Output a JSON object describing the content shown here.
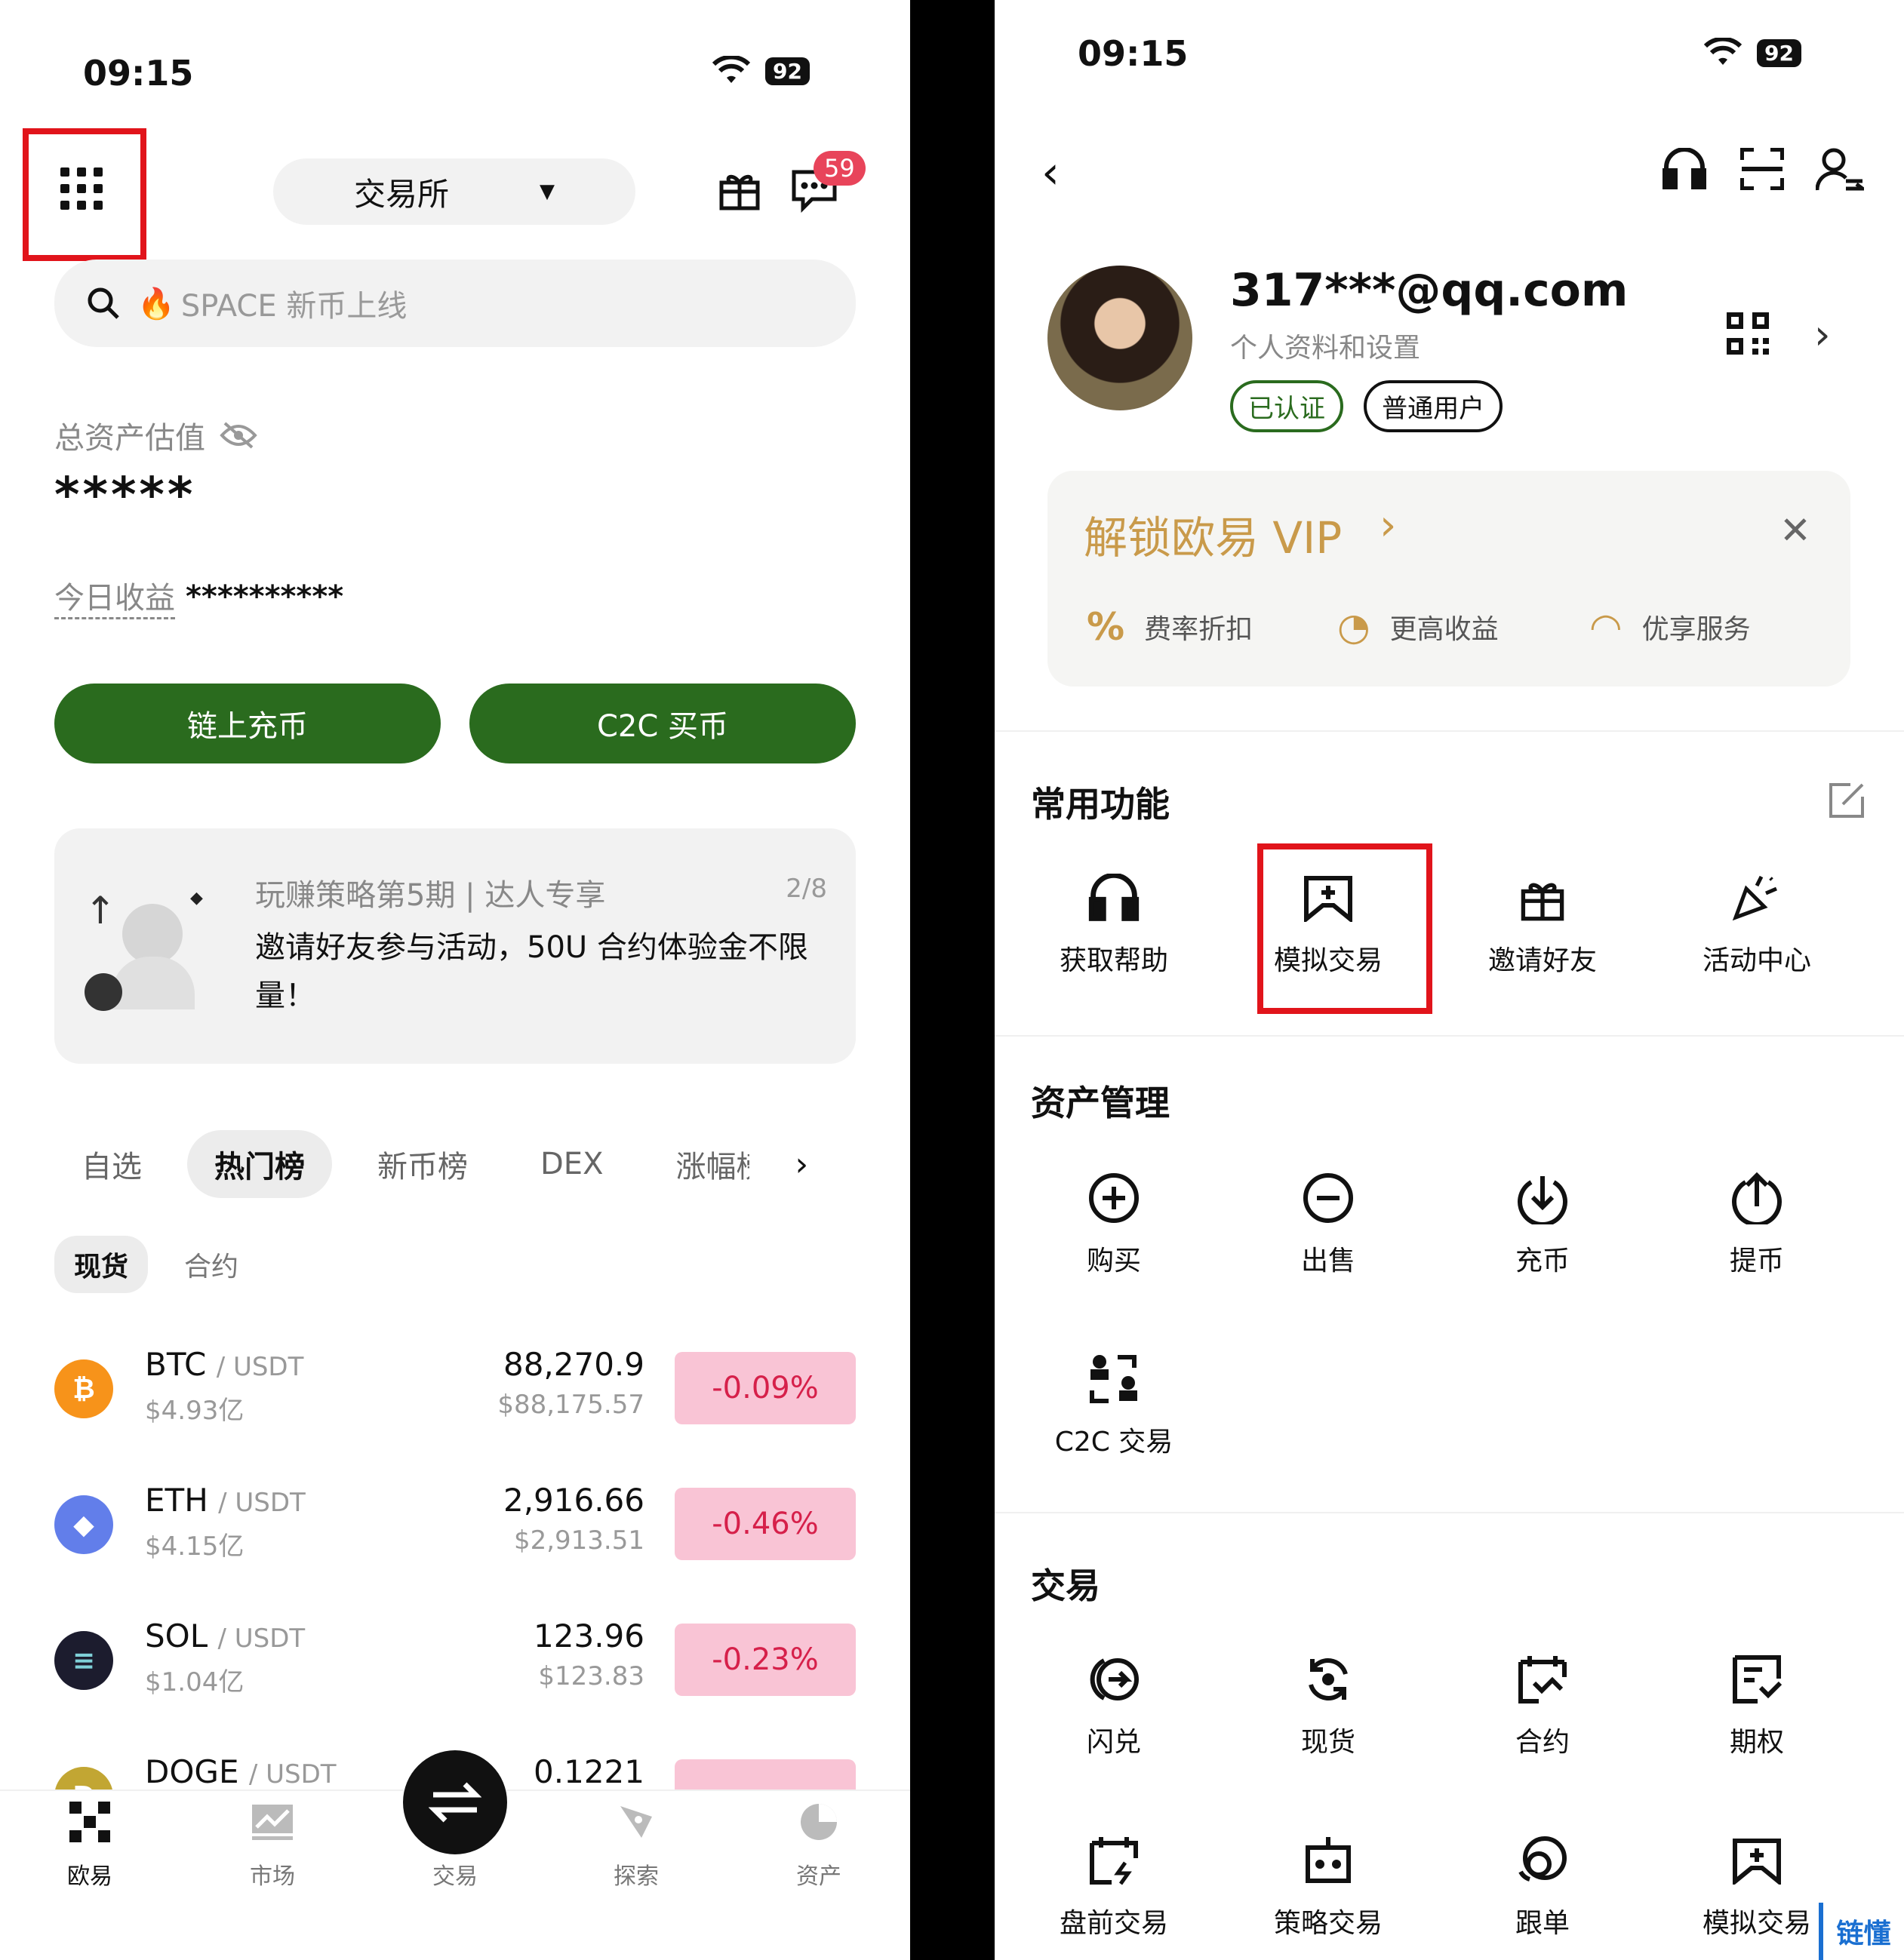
{
  "left": {
    "status": {
      "time": "09:15",
      "battery": "92"
    },
    "header": {
      "exchange_label": "交易所",
      "message_count": "59"
    },
    "search": {
      "placeholder": "SPACE 新币上线"
    },
    "assets": {
      "label": "总资产估值",
      "value": "*****",
      "today_label": "今日收益",
      "today_value": "**********"
    },
    "buttons": {
      "deposit": "链上充币",
      "c2c": "C2C 买币"
    },
    "promo": {
      "title": "玩赚策略第5期 | 达人专享",
      "page": "2/8",
      "text": "邀请好友参与活动，50U 合约体验金不限量！"
    },
    "tabs": [
      "自选",
      "热门榜",
      "新币榜",
      "DEX",
      "涨幅榜"
    ],
    "subtabs": [
      "现货",
      "合约"
    ],
    "coins": [
      {
        "symbol": "BTC",
        "quote": "/ USDT",
        "volume": "$4.93亿",
        "price": "88,270.9",
        "fiat": "$88,175.57",
        "change": "-0.09%",
        "color": "#f7931a",
        "glyph": "₿"
      },
      {
        "symbol": "ETH",
        "quote": "/ USDT",
        "volume": "$4.15亿",
        "price": "2,916.66",
        "fiat": "$2,913.51",
        "change": "-0.46%",
        "color": "#627eea",
        "glyph": "◆"
      },
      {
        "symbol": "SOL",
        "quote": "/ USDT",
        "volume": "$1.04亿",
        "price": "123.96",
        "fiat": "$123.83",
        "change": "-0.23%",
        "color": "#1c1c2e",
        "glyph": "≡"
      },
      {
        "symbol": "DOGE",
        "quote": "/ USDT",
        "volume": "",
        "price": "0.1221",
        "fiat": "",
        "change": "",
        "color": "#c2a633",
        "glyph": "Ð"
      }
    ],
    "nav": [
      "欧易",
      "市场",
      "交易",
      "探索",
      "资产"
    ]
  },
  "right": {
    "status": {
      "time": "09:15",
      "battery": "92"
    },
    "profile": {
      "email": "317***@qq.com",
      "subtitle": "个人资料和设置",
      "verified": "已认证",
      "user_type": "普通用户"
    },
    "vip": {
      "title": "解锁欧易 VIP",
      "perks": [
        "费率折扣",
        "更高收益",
        "优享服务"
      ]
    },
    "common": {
      "title": "常用功能",
      "items": [
        "获取帮助",
        "模拟交易",
        "邀请好友",
        "活动中心"
      ]
    },
    "asset_mgmt": {
      "title": "资产管理",
      "items": [
        "购买",
        "出售",
        "充币",
        "提币",
        "C2C 交易"
      ]
    },
    "trade": {
      "title": "交易",
      "items": [
        "闪兑",
        "现货",
        "合约",
        "期权",
        "盘前交易",
        "策略交易",
        "跟单",
        "模拟交易"
      ]
    },
    "watermark": "链懂"
  },
  "colors": {
    "accent_green": "#2a6b1e",
    "highlight_red": "#e1141b",
    "down_pink": "#f9c4d5",
    "down_text": "#d6204a",
    "vip_gold": "#c99a4a"
  }
}
